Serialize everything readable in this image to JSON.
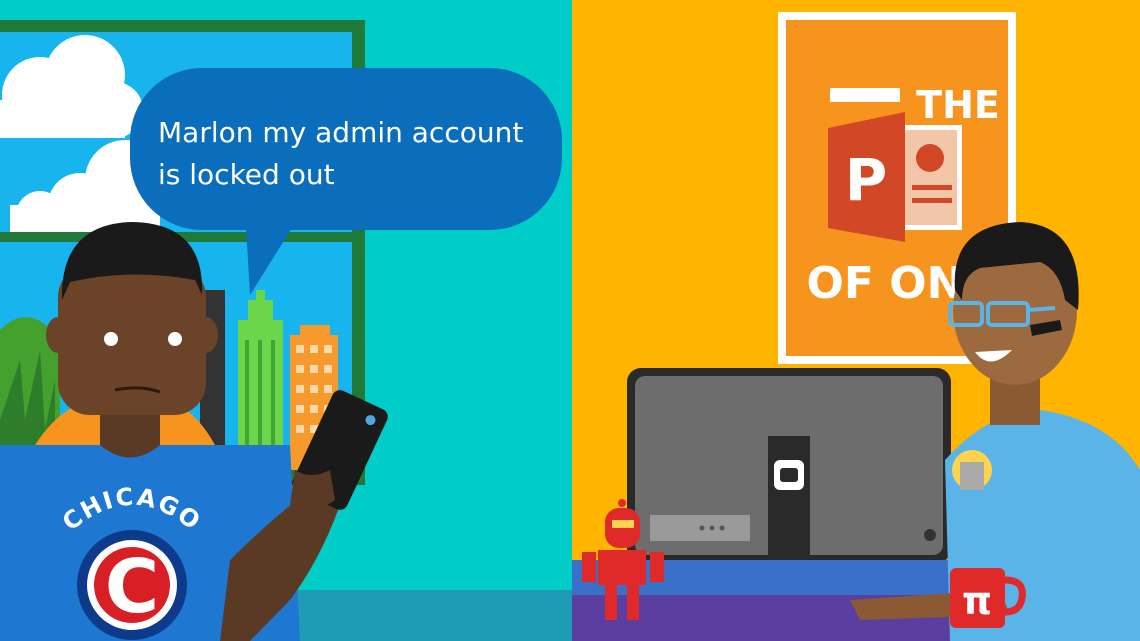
{
  "speech_bubble": {
    "line1": "Marlon my admin account",
    "line2": "is locked out"
  },
  "shirt_text": "CHICAGO",
  "shirt_logo_letter": "C",
  "poster": {
    "top_text": "THE",
    "bottom_text": "OF ONE",
    "logo_letter": "P"
  },
  "mug_symbol": "π",
  "colors": {
    "left_background": "#00c8c8",
    "right_background": "#ffb400",
    "bubble": "#0a6ebd",
    "poster": "#f7941d",
    "shirt_left": "#1e78d2",
    "shirt_right": "#5ab4e8",
    "robot": "#e02a2a"
  }
}
